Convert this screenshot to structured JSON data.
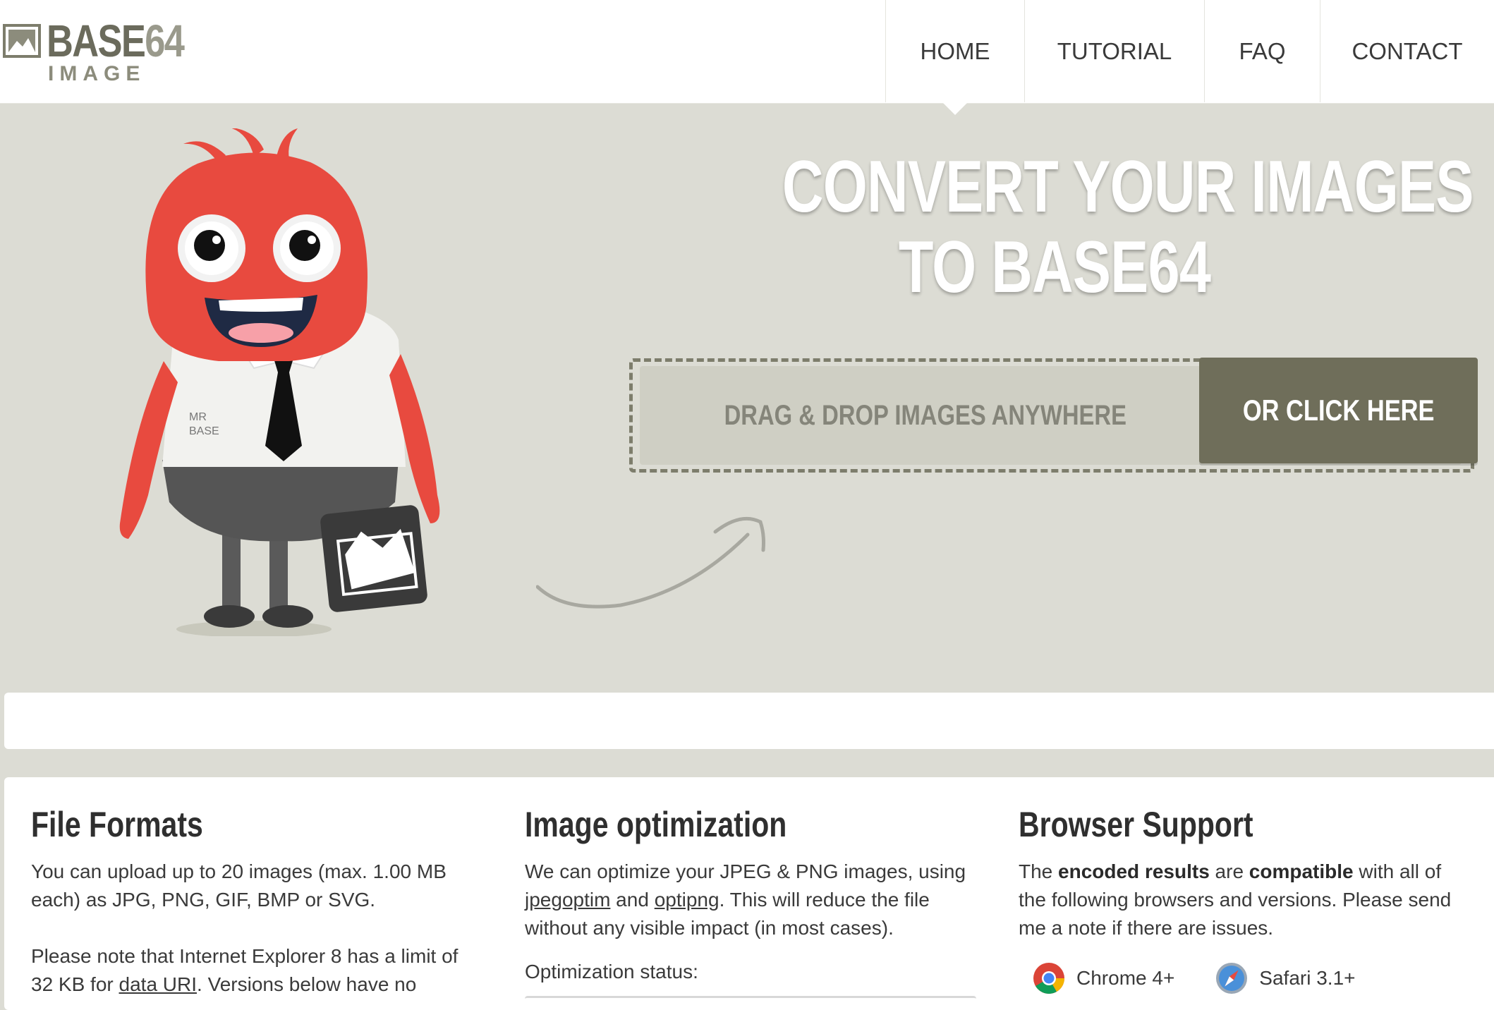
{
  "header": {
    "logo_title_main": "BASE",
    "logo_title_num": "64",
    "logo_subtitle": "IMAGE",
    "nav": [
      {
        "label": "HOME"
      },
      {
        "label": "TUTORIAL"
      },
      {
        "label": "FAQ"
      },
      {
        "label": "CONTACT"
      }
    ]
  },
  "hero": {
    "title_line1": "CONVERT YOUR IMAGES",
    "title_line2": "TO BASE64",
    "dropzone_text": "DRAG & DROP IMAGES ANYWHERE",
    "click_button_label": "OR CLICK HERE",
    "mascot_shirt_label_line1": "MR",
    "mascot_shirt_label_line2": "BASE"
  },
  "features": {
    "file_formats": {
      "title": "File Formats",
      "p1": "You can upload up to 20 images (max. 1.00 MB each) as JPG, PNG, GIF, BMP or SVG.",
      "p2_before": "Please note that Internet Explorer 8 has a limit of 32 KB for ",
      "p2_link": "data URI",
      "p2_after": ". Versions below have no"
    },
    "image_optimization": {
      "title": "Image optimization",
      "p1_before": "We can optimize your JPEG & PNG images, using ",
      "link1": "jpegoptim",
      "p1_mid": " and ",
      "link2": "optipng",
      "p1_after": ". This will reduce the file without any visible impact (in most cases).",
      "status_label": "Optimization status:"
    },
    "browser_support": {
      "title": "Browser Support",
      "p_1": "The ",
      "p_b1": "encoded results",
      "p_2": " are ",
      "p_b2": "compatible",
      "p_3": " with all of the following browsers and versions. Please send me a note if there are issues.",
      "browsers": [
        {
          "name": "Chrome 4+",
          "icon": "chrome-icon"
        },
        {
          "name": "Safari 3.1+",
          "icon": "safari-icon"
        }
      ]
    }
  },
  "colors": {
    "hero_bg": "#dcdcd4",
    "button_bg": "#6f6e5a",
    "mascot_red": "#e84a3f"
  }
}
